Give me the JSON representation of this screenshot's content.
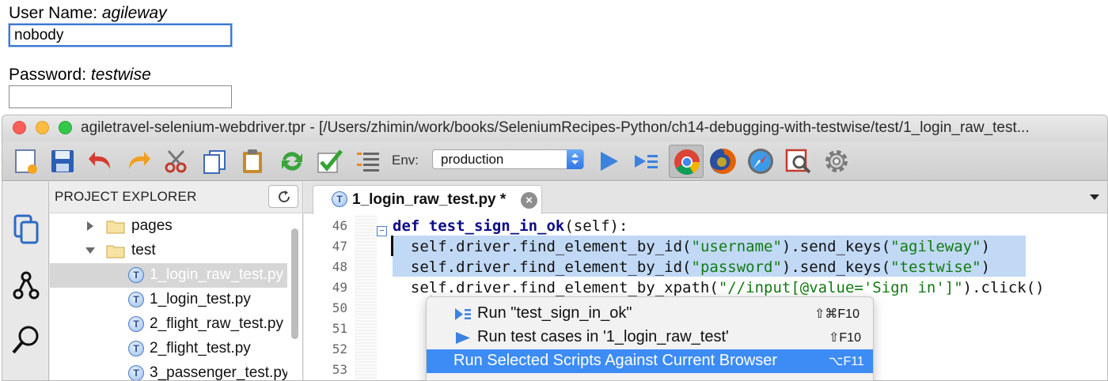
{
  "form": {
    "username_label": "User Name:",
    "username_hint": "agileway",
    "username_value": "nobody",
    "password_label": "Password:",
    "password_hint": "testwise",
    "password_value": ""
  },
  "window": {
    "title": "agiletravel-selenium-webdriver.tpr - [/Users/zhimin/work/books/SeleniumRecipes-Python/ch14-debugging-with-testwise/test/1_login_raw_test..."
  },
  "toolbar": {
    "icons": [
      "new-project-icon",
      "save-icon",
      "undo-icon",
      "redo-icon",
      "cut-icon",
      "copy-icon",
      "paste-icon",
      "refresh-icon",
      "check-icon",
      "outline-icon"
    ],
    "env_label": "Env:",
    "env_value": "production",
    "run_icons": [
      "run-icon",
      "run-all-icon",
      "chrome-icon",
      "firefox-icon",
      "safari-icon",
      "inspector-icon",
      "settings-icon"
    ]
  },
  "sidebar": {
    "icons": [
      "files-icon",
      "git-icon",
      "search-icon"
    ]
  },
  "explorer": {
    "title": "PROJECT EXPLORER",
    "items": [
      {
        "type": "folder",
        "label": "pages",
        "expanded": false
      },
      {
        "type": "folder",
        "label": "test",
        "expanded": true
      },
      {
        "type": "file",
        "label": "1_login_raw_test.py",
        "selected": true
      },
      {
        "type": "file",
        "label": "1_login_test.py"
      },
      {
        "type": "file",
        "label": "2_flight_raw_test.py"
      },
      {
        "type": "file",
        "label": "2_flight_test.py"
      },
      {
        "type": "file",
        "label": "3_passenger_test.py"
      }
    ]
  },
  "editor": {
    "tab_label": "1_login_raw_test.py *",
    "tab_icon_letter": "T",
    "lines": [
      {
        "no": "46",
        "parts": [
          [
            "kw",
            "def "
          ],
          [
            "fn",
            "test_sign_in_ok"
          ],
          [
            "plain",
            "(self):"
          ]
        ]
      },
      {
        "no": "47",
        "parts": [
          [
            "plain",
            "  self.driver.find_element_by_id("
          ],
          [
            "str",
            "\"username\""
          ],
          [
            "plain",
            ").send_keys("
          ],
          [
            "str",
            "\"agileway\""
          ],
          [
            "plain",
            ")"
          ]
        ]
      },
      {
        "no": "48",
        "parts": [
          [
            "plain",
            "  self.driver.find_element_by_id("
          ],
          [
            "str",
            "\"password\""
          ],
          [
            "plain",
            ").send_keys("
          ],
          [
            "str",
            "\"testwise\""
          ],
          [
            "plain",
            ")"
          ]
        ]
      },
      {
        "no": "49",
        "parts": [
          [
            "plain",
            "  self.driver.find_element_by_xpath("
          ],
          [
            "str",
            "\"//input[@value='Sign in']\""
          ],
          [
            "plain",
            ").click()"
          ]
        ]
      },
      {
        "no": "50",
        "parts": []
      },
      {
        "no": "51",
        "parts": []
      },
      {
        "no": "52",
        "parts": []
      },
      {
        "no": "53",
        "parts": []
      }
    ]
  },
  "context_menu": {
    "items": [
      {
        "label": "Run \"test_sign_in_ok\"",
        "shortcut": "⇧⌘F10",
        "icon": "run-test-icon"
      },
      {
        "label": "Run test cases in '1_login_raw_test'",
        "shortcut": "⇧F10",
        "icon": "run-file-icon"
      },
      {
        "label": "Run Selected Scripts Against Current Browser",
        "shortcut": "⌥F11",
        "icon": ""
      }
    ]
  },
  "colors": {
    "selection": "#c1d9f5",
    "menu_highlight": "#3d8cf5",
    "keyword": "#0d0d88",
    "string": "#127a12"
  }
}
